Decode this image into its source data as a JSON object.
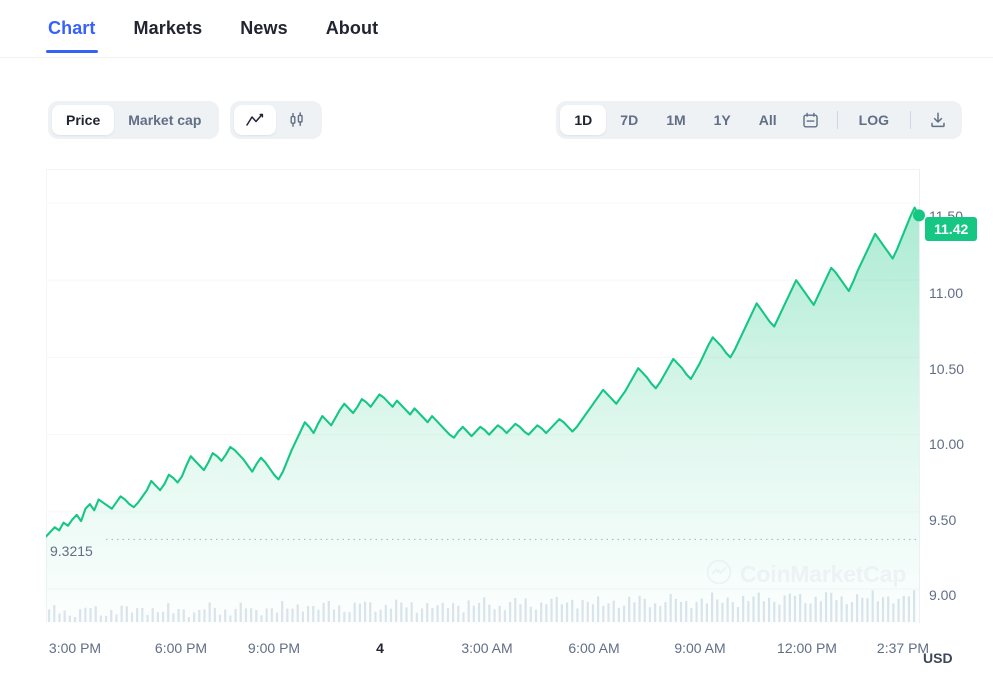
{
  "tabs": [
    {
      "label": "Chart",
      "active": true
    },
    {
      "label": "Markets",
      "active": false
    },
    {
      "label": "News",
      "active": false
    },
    {
      "label": "About",
      "active": false
    }
  ],
  "toolbar": {
    "metric_group": [
      {
        "label": "Price",
        "active": true
      },
      {
        "label": "Market cap",
        "active": false
      }
    ],
    "chart_type_group": [
      {
        "icon": "line-chart-icon",
        "active": true
      },
      {
        "icon": "candlestick-icon",
        "active": false
      }
    ],
    "range_group": [
      {
        "label": "1D",
        "active": true
      },
      {
        "label": "7D",
        "active": false
      },
      {
        "label": "1M",
        "active": false
      },
      {
        "label": "1Y",
        "active": false
      },
      {
        "label": "All",
        "active": false
      }
    ],
    "calendar_icon": "calendar-icon",
    "log_label": "LOG",
    "download_icon": "download-icon"
  },
  "chart_data": {
    "type": "line",
    "title": "",
    "xlabel": "",
    "ylabel": "",
    "currency": "USD",
    "grid": true,
    "legend_position": "none",
    "line_color": "#16c784",
    "area_fill_top": "#16c784",
    "current_price_label": "11.42",
    "low_marker_label": "9.3215",
    "low_marker_value": 9.3215,
    "ylim": [
      8.78,
      11.72
    ],
    "yticks": [
      11.5,
      11.0,
      10.5,
      10.0,
      9.5,
      9.0
    ],
    "ytick_labels": [
      "11.50",
      "11.00",
      "10.50",
      "10.00",
      "9.50",
      "9.00"
    ],
    "xtick_labels": [
      "3:00 PM",
      "6:00 PM",
      "9:00 PM",
      "4",
      "3:00 AM",
      "6:00 AM",
      "9:00 AM",
      "12:00 PM",
      "2:37 PM"
    ],
    "xtick_bold_index": 3,
    "values": [
      9.34,
      9.37,
      9.4,
      9.38,
      9.43,
      9.41,
      9.45,
      9.48,
      9.44,
      9.52,
      9.55,
      9.51,
      9.58,
      9.56,
      9.54,
      9.52,
      9.56,
      9.6,
      9.58,
      9.55,
      9.53,
      9.56,
      9.6,
      9.64,
      9.7,
      9.67,
      9.64,
      9.68,
      9.74,
      9.72,
      9.69,
      9.73,
      9.8,
      9.86,
      9.83,
      9.8,
      9.77,
      9.82,
      9.88,
      9.86,
      9.83,
      9.87,
      9.92,
      9.9,
      9.87,
      9.84,
      9.8,
      9.76,
      9.81,
      9.85,
      9.82,
      9.78,
      9.74,
      9.71,
      9.76,
      9.83,
      9.9,
      9.96,
      10.02,
      10.08,
      10.05,
      10.01,
      10.07,
      10.12,
      10.09,
      10.06,
      10.11,
      10.16,
      10.2,
      10.17,
      10.14,
      10.18,
      10.23,
      10.21,
      10.18,
      10.22,
      10.26,
      10.24,
      10.21,
      10.18,
      10.22,
      10.19,
      10.16,
      10.13,
      10.17,
      10.14,
      10.11,
      10.08,
      10.12,
      10.09,
      10.06,
      10.03,
      10.0,
      9.98,
      10.02,
      10.05,
      10.02,
      9.99,
      10.02,
      10.05,
      10.03,
      10.0,
      10.03,
      10.06,
      10.04,
      10.01,
      10.04,
      10.07,
      10.05,
      10.02,
      10.0,
      10.03,
      10.06,
      10.04,
      10.01,
      10.04,
      10.07,
      10.1,
      10.08,
      10.05,
      10.02,
      10.05,
      10.09,
      10.13,
      10.17,
      10.21,
      10.25,
      10.29,
      10.26,
      10.23,
      10.2,
      10.24,
      10.28,
      10.33,
      10.38,
      10.43,
      10.4,
      10.37,
      10.33,
      10.3,
      10.34,
      10.39,
      10.44,
      10.49,
      10.46,
      10.43,
      10.39,
      10.36,
      10.41,
      10.46,
      10.52,
      10.58,
      10.63,
      10.6,
      10.57,
      10.53,
      10.5,
      10.55,
      10.61,
      10.67,
      10.73,
      10.79,
      10.85,
      10.81,
      10.77,
      10.73,
      10.7,
      10.76,
      10.82,
      10.88,
      10.94,
      11.0,
      10.96,
      10.92,
      10.88,
      10.84,
      10.9,
      10.96,
      11.02,
      11.08,
      11.05,
      11.01,
      10.97,
      10.93,
      10.99,
      11.06,
      11.12,
      11.18,
      11.24,
      11.3,
      11.26,
      11.22,
      11.18,
      11.14,
      11.2,
      11.27,
      11.34,
      11.41,
      11.47,
      11.42
    ],
    "volume_note": "volume histogram rendered along the bottom of the plot",
    "watermark": "CoinMarketCap"
  }
}
